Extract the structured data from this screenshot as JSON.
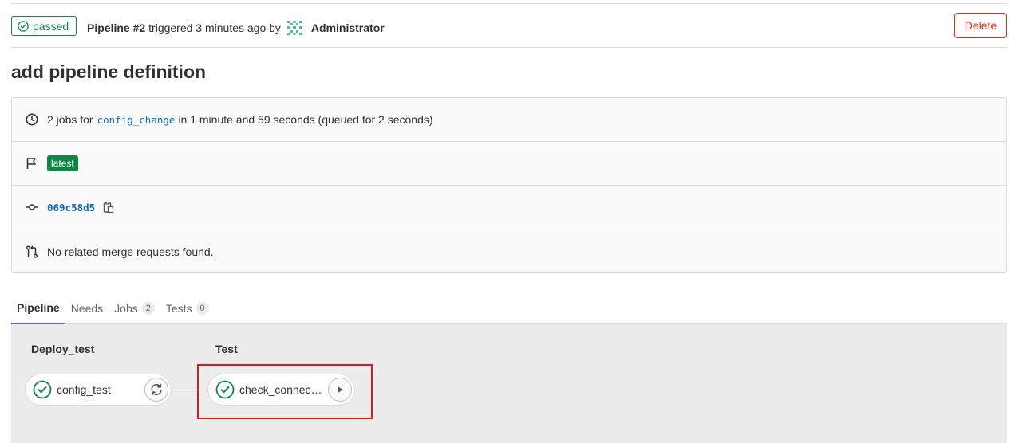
{
  "header": {
    "status": "passed",
    "pipeline_label": "Pipeline #2",
    "triggered_text": "triggered 3 minutes ago by",
    "user": "Administrator",
    "delete_label": "Delete"
  },
  "title": "add pipeline definition",
  "info": {
    "jobs_prefix": "2 jobs for",
    "branch": "config_change",
    "jobs_suffix": "in 1 minute and 59 seconds (queued for 2 seconds)",
    "badge": "latest",
    "commit_sha": "069c58d5",
    "merge_requests": "No related merge requests found."
  },
  "tabs": [
    {
      "label": "Pipeline",
      "active": true
    },
    {
      "label": "Needs"
    },
    {
      "label": "Jobs",
      "count": "2"
    },
    {
      "label": "Tests",
      "count": "0"
    }
  ],
  "stages": [
    {
      "name": "Deploy_test",
      "jobs": [
        {
          "name": "config_test",
          "status": "passed",
          "action": "retry"
        }
      ]
    },
    {
      "name": "Test",
      "jobs": [
        {
          "name": "check_connec…",
          "status": "passed",
          "action": "play"
        }
      ]
    }
  ],
  "colors": {
    "success": "#108548",
    "danger": "#dd2b0e",
    "link": "#1068bf",
    "tab_active": "#6666c4",
    "highlight": "#e2171c"
  }
}
